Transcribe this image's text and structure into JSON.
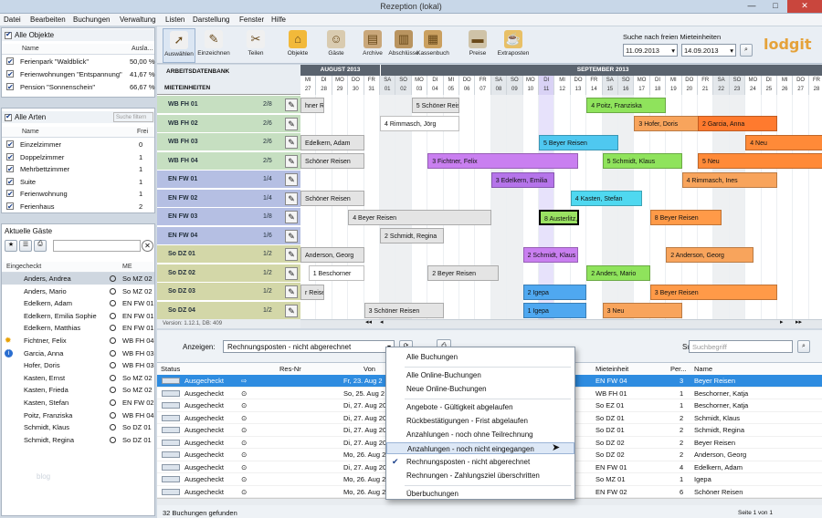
{
  "window": {
    "title": "Rezeption (lokal)",
    "min": "—",
    "max": "□",
    "close": "✕"
  },
  "menu": [
    "Datei",
    "Bearbeiten",
    "Buchungen",
    "Verwaltung",
    "Listen",
    "Darstellung",
    "Fenster",
    "Hilfe"
  ],
  "objects": {
    "all_label": "Alle Objekte",
    "col_name": "Name",
    "col_util": "Ausla...",
    "items": [
      {
        "name": "Ferienpark \"Waldblick\"",
        "pct": "50,00 %"
      },
      {
        "name": "Ferienwohnungen \"Entspannung\"",
        "pct": "41,67 %"
      },
      {
        "name": "Pension \"Sonnenschein\"",
        "pct": "66,67 %"
      }
    ]
  },
  "types": {
    "all_label": "Alle Arten",
    "filter_placeholder": "Suche filtern",
    "col_name": "Name",
    "col_free": "Frei",
    "items": [
      {
        "name": "Einzelzimmer",
        "free": "0"
      },
      {
        "name": "Doppelzimmer",
        "free": "1"
      },
      {
        "name": "Mehrbettzimmer",
        "free": "1"
      },
      {
        "name": "Suite",
        "free": "1"
      },
      {
        "name": "Ferienwohnung",
        "free": "1"
      },
      {
        "name": "Ferienhaus",
        "free": "2"
      }
    ]
  },
  "guests": {
    "title": "Aktuelle Gäste",
    "col_checked": "Eingecheckt",
    "col_me": "ME",
    "watermark": "blog",
    "items": [
      {
        "name": "Anders, Andrea",
        "me": "So MZ 02",
        "mark": ""
      },
      {
        "name": "Anders, Mario",
        "me": "So MZ 02",
        "mark": ""
      },
      {
        "name": "Edelkern, Adam",
        "me": "EN FW 01",
        "mark": ""
      },
      {
        "name": "Edelkern, Emilia Sophie",
        "me": "EN FW 01",
        "mark": ""
      },
      {
        "name": "Edelkern, Matthias",
        "me": "EN FW 01",
        "mark": ""
      },
      {
        "name": "Fichtner, Felix",
        "me": "WB FH 04",
        "mark": "sun"
      },
      {
        "name": "Garcia, Anna",
        "me": "WB FH 03",
        "mark": "info"
      },
      {
        "name": "Hofer, Doris",
        "me": "WB FH 03",
        "mark": ""
      },
      {
        "name": "Kasten, Ernst",
        "me": "So MZ 02",
        "mark": ""
      },
      {
        "name": "Kasten, Frieda",
        "me": "So MZ 02",
        "mark": ""
      },
      {
        "name": "Kasten, Stefan",
        "me": "EN FW 02",
        "mark": ""
      },
      {
        "name": "Poitz, Franziska",
        "me": "WB FH 04",
        "mark": ""
      },
      {
        "name": "Schmidt, Klaus",
        "me": "So DZ 01",
        "mark": ""
      },
      {
        "name": "Schmidt, Regina",
        "me": "So DZ 01",
        "mark": ""
      }
    ]
  },
  "toolbar": {
    "buttons": [
      "Auswählen",
      "Einzeichnen",
      "Teilen",
      "Objekte",
      "Gäste",
      "Archive",
      "Abschlüsse",
      "Kassenbuch",
      "Preise",
      "Extraposten"
    ],
    "search_title": "Suche nach freien Mieteinheiten",
    "date_from": "11.09.2013",
    "date_to": "14.09.2013",
    "logo": "lodgit"
  },
  "gantt": {
    "left_hdr1": "ARBEITSDATENBANK",
    "left_hdr2": "MIETEINHEITEN",
    "months": [
      {
        "label": "AUGUST 2013"
      },
      {
        "label": "SEPTEMBER 2013"
      }
    ],
    "days": [
      [
        "MI",
        "27"
      ],
      [
        "DI",
        "28"
      ],
      [
        "MO",
        "29"
      ],
      [
        "DO",
        "30"
      ],
      [
        "FR",
        "31"
      ],
      [
        "SA",
        "01"
      ],
      [
        "SO",
        "02"
      ],
      [
        "MO",
        "03"
      ],
      [
        "DI",
        "04"
      ],
      [
        "MI",
        "05"
      ],
      [
        "DO",
        "06"
      ],
      [
        "FR",
        "07"
      ],
      [
        "SA",
        "08"
      ],
      [
        "SO",
        "09"
      ],
      [
        "MO",
        "10"
      ],
      [
        "DI",
        "11"
      ],
      [
        "MI",
        "12"
      ],
      [
        "DO",
        "13"
      ],
      [
        "FR",
        "14"
      ],
      [
        "SA",
        "15"
      ],
      [
        "SO",
        "16"
      ],
      [
        "MO",
        "17"
      ],
      [
        "DI",
        "18"
      ],
      [
        "MI",
        "19"
      ],
      [
        "DO",
        "20"
      ],
      [
        "FR",
        "21"
      ],
      [
        "SA",
        "22"
      ],
      [
        "SO",
        "23"
      ],
      [
        "MO",
        "24"
      ],
      [
        "DI",
        "25"
      ],
      [
        "MI",
        "26"
      ],
      [
        "DO",
        "27"
      ],
      [
        "FR",
        "28"
      ]
    ],
    "version": "Version: 1.12.1, DB: 409",
    "units": [
      {
        "name": "WB FH 01",
        "cnt": "2/8"
      },
      {
        "name": "WB FH 02",
        "cnt": "2/6"
      },
      {
        "name": "WB FH 03",
        "cnt": "2/6"
      },
      {
        "name": "WB FH 04",
        "cnt": "2/5"
      },
      {
        "name": "EN FW 01",
        "cnt": "1/4"
      },
      {
        "name": "EN FW 02",
        "cnt": "1/4"
      },
      {
        "name": "EN FW 03",
        "cnt": "1/8"
      },
      {
        "name": "EN FW 04",
        "cnt": "1/6"
      },
      {
        "name": "So DZ 01",
        "cnt": "1/2"
      },
      {
        "name": "So DZ 02",
        "cnt": "1/2"
      },
      {
        "name": "So DZ 03",
        "cnt": "1/2"
      },
      {
        "name": "So DZ 04",
        "cnt": "1/2"
      }
    ],
    "bars": [
      {
        "row": 0,
        "from": 0,
        "to": 1.5,
        "label": "hner Reisen",
        "color": "#e4e4e4"
      },
      {
        "row": 0,
        "from": 7,
        "to": 10,
        "label": "5 Schöner Reisen",
        "color": "#e4e4e4"
      },
      {
        "row": 0,
        "from": 18,
        "to": 23,
        "label": "4 Poitz, Franziska",
        "color": "#8fe35c"
      },
      {
        "row": 1,
        "from": 5,
        "to": 10,
        "label": "4 Rimmasch, Jörg",
        "color": "#ffffff"
      },
      {
        "row": 1,
        "from": 21,
        "to": 26,
        "label": "3 Hofer, Doris",
        "color": "#f8a45c"
      },
      {
        "row": 1,
        "from": 25,
        "to": 30,
        "label": "2 Garcia, Anna",
        "color": "#ff7a2e"
      },
      {
        "row": 2,
        "from": 0,
        "to": 4,
        "label": "Edelkern, Adam",
        "color": "#e4e4e4"
      },
      {
        "row": 2,
        "from": 15,
        "to": 20,
        "label": "5 Beyer Reisen",
        "color": "#4fc8f0"
      },
      {
        "row": 2,
        "from": 28,
        "to": 33,
        "label": "4 Neu",
        "color": "#ff8a38"
      },
      {
        "row": 3,
        "from": 0,
        "to": 4,
        "label": "Schöner Reisen",
        "color": "#e4e4e4"
      },
      {
        "row": 3,
        "from": 8,
        "to": 17.5,
        "label": "3 Fichtner, Felix",
        "color": "#c97ff0"
      },
      {
        "row": 3,
        "from": 19,
        "to": 24,
        "label": "5 Schmidt, Klaus",
        "color": "#8fe35c"
      },
      {
        "row": 3,
        "from": 25,
        "to": 33,
        "label": "5 Neu",
        "color": "#ff8a38"
      },
      {
        "row": 4,
        "from": 12,
        "to": 16,
        "label": "3 Edelkern, Emilia",
        "color": "#b574ea"
      },
      {
        "row": 4,
        "from": 24,
        "to": 30,
        "label": "4 Rimmasch, Ines",
        "color": "#f8a45c"
      },
      {
        "row": 5,
        "from": 0,
        "to": 4,
        "label": "Schöner Reisen",
        "color": "#e4e4e4"
      },
      {
        "row": 5,
        "from": 17,
        "to": 21.5,
        "label": "4 Kasten, Stefan",
        "color": "#4fd8f0"
      },
      {
        "row": 6,
        "from": 3,
        "to": 12,
        "label": "4 Beyer Reisen",
        "color": "#e4e4e4"
      },
      {
        "row": 6,
        "from": 15,
        "to": 17.5,
        "label": "8 Austerlitz, ...",
        "color": "#9ae262"
      },
      {
        "row": 6,
        "from": 22,
        "to": 26.5,
        "label": "8 Beyer Reisen",
        "color": "#ff9a48"
      },
      {
        "row": 7,
        "from": 5,
        "to": 9,
        "label": "2 Schmidt, Regina",
        "color": "#e4e4e4"
      },
      {
        "row": 8,
        "from": 0,
        "to": 4,
        "label": "Anderson, Georg",
        "color": "#e4e4e4"
      },
      {
        "row": 8,
        "from": 14,
        "to": 17.5,
        "label": "2 Schmidt, Klaus",
        "color": "#c97ff0"
      },
      {
        "row": 8,
        "from": 23,
        "to": 28.5,
        "label": "2 Anderson, Georg",
        "color": "#f8a45c"
      },
      {
        "row": 9,
        "from": 0.5,
        "to": 4,
        "label": "1 Beschorner",
        "color": "#ffffff"
      },
      {
        "row": 9,
        "from": 8,
        "to": 12.5,
        "label": "2 Beyer Reisen",
        "color": "#e4e4e4"
      },
      {
        "row": 9,
        "from": 18,
        "to": 22,
        "label": "2 Anders, Mario",
        "color": "#8fe35c"
      },
      {
        "row": 10,
        "from": 0,
        "to": 1.5,
        "label": "r Reisen",
        "color": "#e4e4e4"
      },
      {
        "row": 10,
        "from": 14,
        "to": 18,
        "label": "2 Igepa",
        "color": "#4fa8f0"
      },
      {
        "row": 10,
        "from": 22,
        "to": 30,
        "label": "3 Beyer Reisen",
        "color": "#ff9a48"
      },
      {
        "row": 11,
        "from": 4,
        "to": 9,
        "label": "3 Schöner Reisen",
        "color": "#e4e4e4"
      },
      {
        "row": 11,
        "from": 14,
        "to": 18,
        "label": "1 Igepa",
        "color": "#4fa8f0"
      },
      {
        "row": 11,
        "from": 19,
        "to": 24,
        "label": "3 Neu",
        "color": "#f8a45c"
      }
    ]
  },
  "bottom": {
    "show_label": "Anzeigen:",
    "show_value": "Rechnungsposten - nicht abgerechnet",
    "search_label": "Suchen:",
    "search_placeholder": "Suchbegriff",
    "footer_left": "32 Buchungen gefunden",
    "footer_right": "Seite 1 von 1",
    "cols": [
      "Status",
      "Res-Nr",
      "Von",
      "Mieteinheit",
      "Per...",
      "Name"
    ],
    "rows": [
      {
        "status": "Ausgecheckt",
        "von": "Fr, 23. Aug 2",
        "me": "EN FW 04",
        "per": "3",
        "name": "Beyer Reisen"
      },
      {
        "status": "Ausgecheckt",
        "von": "So, 25. Aug 2",
        "me": "WB FH 01",
        "per": "1",
        "name": "Beschorner, Katja"
      },
      {
        "status": "Ausgecheckt",
        "von": "Di, 27. Aug 20",
        "me": "So EZ 01",
        "per": "1",
        "name": "Beschorner, Katja"
      },
      {
        "status": "Ausgecheckt",
        "von": "Di, 27. Aug 20",
        "me": "So DZ 01",
        "per": "2",
        "name": "Schmidt, Klaus"
      },
      {
        "status": "Ausgecheckt",
        "von": "Di, 27. Aug 20",
        "me": "So DZ 01",
        "per": "2",
        "name": "Schmidt, Regina"
      },
      {
        "status": "Ausgecheckt",
        "von": "Di, 27. Aug 20",
        "me": "So DZ 02",
        "per": "2",
        "name": "Beyer Reisen"
      },
      {
        "status": "Ausgecheckt",
        "von": "Mo, 26. Aug 2",
        "me": "So DZ 02",
        "per": "2",
        "name": "Anderson, Georg"
      },
      {
        "status": "Ausgecheckt",
        "von": "Di, 27. Aug 20",
        "me": "EN FW 01",
        "per": "4",
        "name": "Edelkern, Adam"
      },
      {
        "status": "Ausgecheckt",
        "von": "Mo, 26. Aug 2",
        "me": "So MZ 01",
        "per": "1",
        "name": "Igepa"
      },
      {
        "status": "Ausgecheckt",
        "von": "Mo, 26. Aug 2",
        "me": "EN FW 02",
        "per": "6",
        "name": "Schöner Reisen"
      }
    ]
  },
  "dropdown": {
    "items": [
      {
        "label": "Alle Buchungen",
        "sep": true
      },
      {
        "label": "Alle Online-Buchungen"
      },
      {
        "label": "Neue Online-Buchungen",
        "sep": true
      },
      {
        "label": "Angebote - Gültigkeit abgelaufen"
      },
      {
        "label": "Rückbestätigungen - Frist abgelaufen"
      },
      {
        "label": "Anzahlungen - noch ohne Teilrechnung"
      },
      {
        "label": "Anzahlungen - noch nicht eingegangen",
        "hl": true
      },
      {
        "label": "Rechnungsposten - nicht abgerechnet",
        "check": true
      },
      {
        "label": "Rechnungen - Zahlungsziel überschritten",
        "sep": true
      },
      {
        "label": "Überbuchungen"
      }
    ]
  }
}
